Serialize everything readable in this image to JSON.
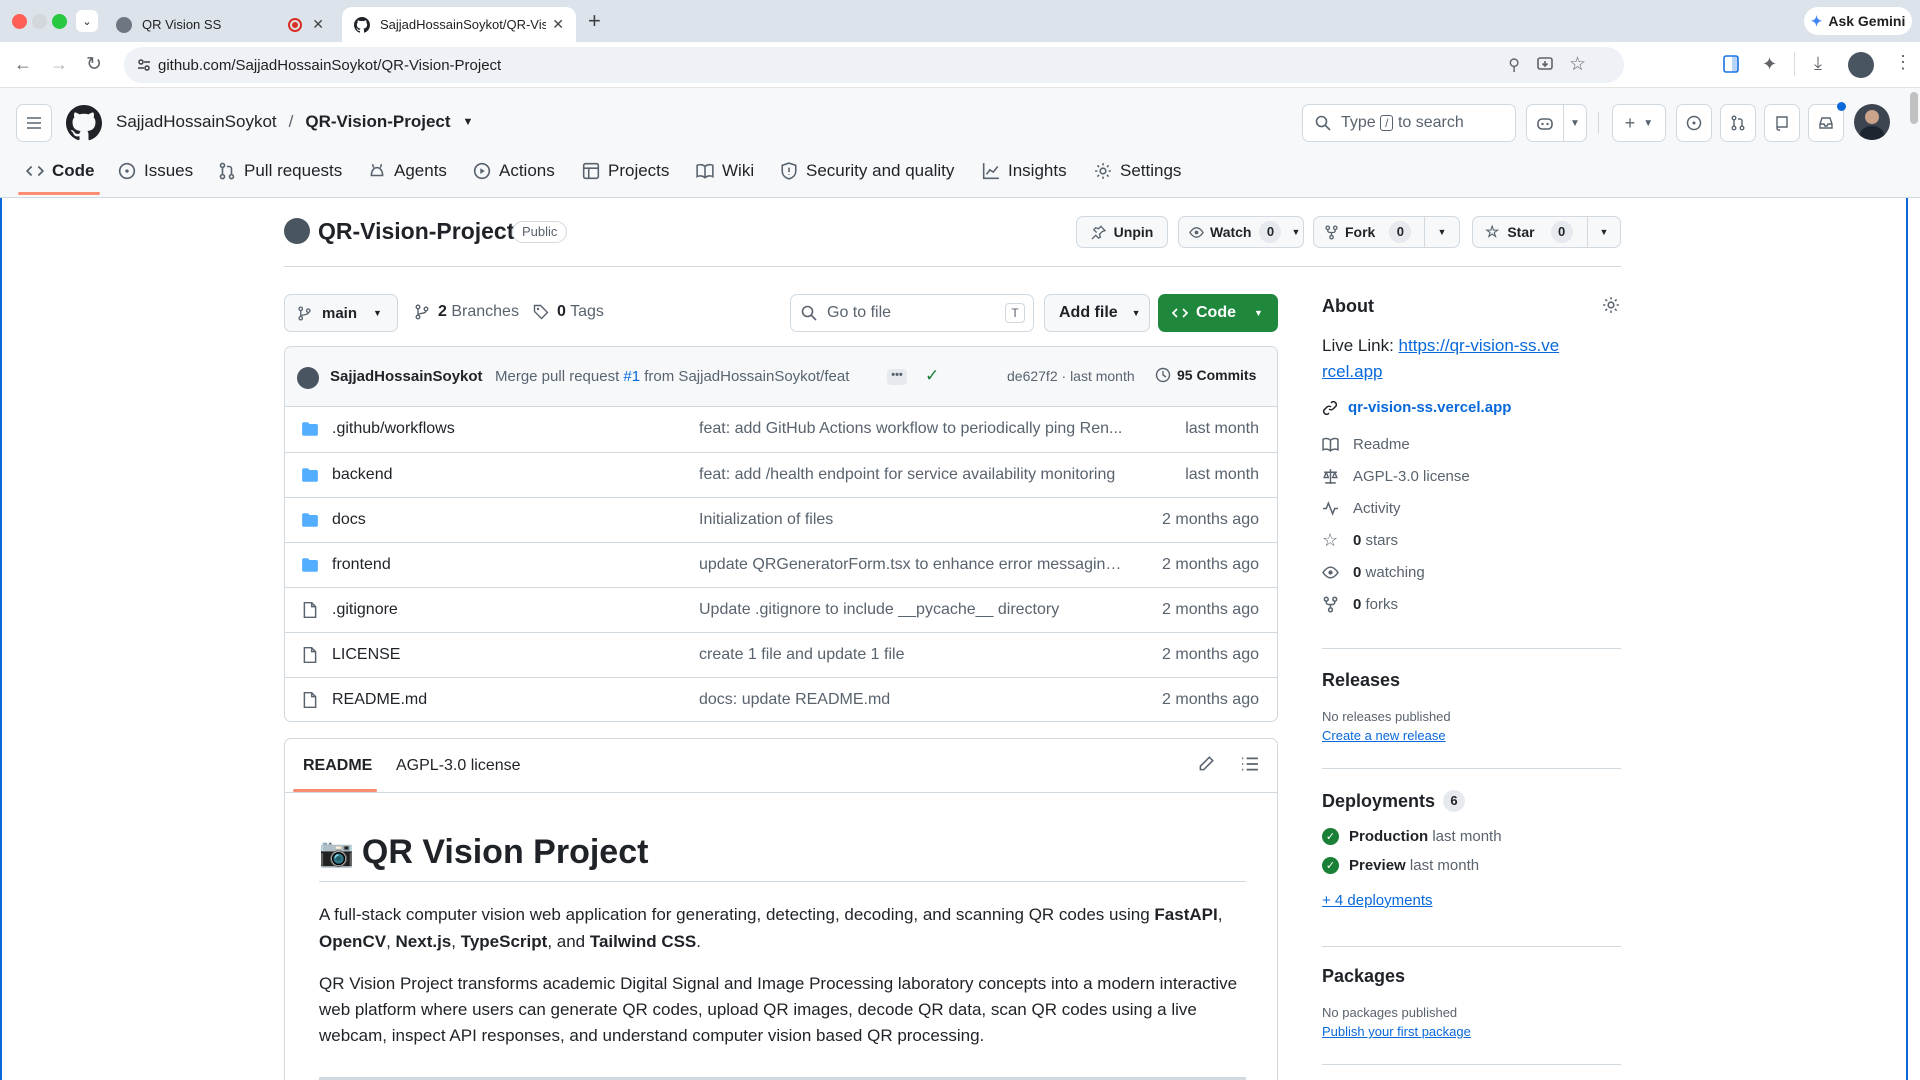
{
  "browser": {
    "tabs": [
      {
        "title": "QR Vision SS",
        "active": false
      },
      {
        "title": "SajjadHossainSoykot/QR-Visi",
        "active": true
      }
    ],
    "url": "github.com/SajjadHossainSoykot/QR-Vision-Project",
    "ask_gemini": "Ask Gemini"
  },
  "header": {
    "owner": "SajjadHossainSoykot",
    "separator": "/",
    "repo": "QR-Vision-Project",
    "search_type": "Type",
    "search_key": "/",
    "search_rest": "to search"
  },
  "nav": [
    {
      "label": "Code",
      "icon": "code-icon",
      "active": true
    },
    {
      "label": "Issues",
      "icon": "issue-icon"
    },
    {
      "label": "Pull requests",
      "icon": "pull-request-icon"
    },
    {
      "label": "Agents",
      "icon": "agents-icon"
    },
    {
      "label": "Actions",
      "icon": "play-icon"
    },
    {
      "label": "Projects",
      "icon": "table-icon"
    },
    {
      "label": "Wiki",
      "icon": "book-icon"
    },
    {
      "label": "Security and quality",
      "icon": "shield-icon"
    },
    {
      "label": "Insights",
      "icon": "graph-icon"
    },
    {
      "label": "Settings",
      "icon": "gear-icon"
    }
  ],
  "repo": {
    "name": "QR-Vision-Project",
    "visibility": "Public",
    "unpin": "Unpin",
    "watch": "Watch",
    "watch_count": "0",
    "fork": "Fork",
    "fork_count": "0",
    "star": "Star",
    "star_count": "0"
  },
  "branchbar": {
    "branch": "main",
    "branches_count": "2",
    "branches_label": "Branches",
    "tags_count": "0",
    "tags_label": "Tags",
    "goto_placeholder": "Go to file",
    "goto_key": "T",
    "add_file": "Add file",
    "code": "Code"
  },
  "commit": {
    "author": "SajjadHossainSoykot",
    "message_pre": "Merge pull request",
    "pr": "#1",
    "message_post": "from SajjadHossainSoykot/feat",
    "sha": "de627f2",
    "dot": "·",
    "time": "last month",
    "commits_count": "95",
    "commits_label": "Commits"
  },
  "files": [
    {
      "name": ".github/workflows",
      "type": "folder",
      "message": "feat: add GitHub Actions workflow to periodically ping Ren...",
      "date": "last month"
    },
    {
      "name": "backend",
      "type": "folder",
      "message": "feat: add /health endpoint for service availability monitoring",
      "date": "last month"
    },
    {
      "name": "docs",
      "type": "folder",
      "message": "Initialization of files",
      "date": "2 months ago"
    },
    {
      "name": "frontend",
      "type": "folder",
      "message": "update QRGeneratorForm.tsx to enhance error messaging ...",
      "date": "2 months ago"
    },
    {
      "name": ".gitignore",
      "type": "file",
      "message": "Update .gitignore to include __pycache__ directory",
      "date": "2 months ago"
    },
    {
      "name": "LICENSE",
      "type": "file",
      "message": "create 1 file and update 1 file",
      "date": "2 months ago"
    },
    {
      "name": "README.md",
      "type": "file",
      "message": "docs: update README.md",
      "date": "2 months ago"
    }
  ],
  "readme": {
    "tab_readme": "README",
    "tab_license": "AGPL-3.0 license",
    "emoji": "📷",
    "title": "QR Vision Project",
    "p1_pre": "A full-stack computer vision web application for generating, detecting, decoding, and scanning QR codes using",
    "p1_b1": "FastAPI",
    "p1_c1": ", ",
    "p1_b2": "OpenCV",
    "p1_c2": ", ",
    "p1_b3": "Next.js",
    "p1_c3": ", ",
    "p1_b4": "TypeScript",
    "p1_c4": ", and ",
    "p1_b5": "Tailwind CSS",
    "p1_end": ".",
    "p2": "QR Vision Project transforms academic Digital Signal and Image Processing laboratory concepts into a modern interactive web platform where users can generate QR codes, upload QR images, decode QR data, scan QR codes using a live webcam, inspect API responses, and understand computer vision based QR processing."
  },
  "about": {
    "title": "About",
    "live_prefix": "Live Link: ",
    "live_url": "https://qr-vision-ss.vercel.app",
    "website": "qr-vision-ss.vercel.app",
    "readme": "Readme",
    "license": "AGPL-3.0 license",
    "activity": "Activity",
    "stars_count": "0",
    "stars": "stars",
    "watching_count": "0",
    "watching": "watching",
    "forks_count": "0",
    "forks": "forks"
  },
  "releases": {
    "title": "Releases",
    "none": "No releases published",
    "create": "Create a new release"
  },
  "deployments": {
    "title": "Deployments",
    "count": "6",
    "items": [
      {
        "name": "Production",
        "time": "last month"
      },
      {
        "name": "Preview",
        "time": "last month"
      }
    ],
    "more": "+ 4 deployments"
  },
  "packages": {
    "title": "Packages",
    "none": "No packages published",
    "publish": "Publish your first package"
  },
  "colors": {
    "accent": "#0969da",
    "primary_button": "#1f883d",
    "active_underline": "#fd8c73",
    "folder": "#54aeff"
  }
}
